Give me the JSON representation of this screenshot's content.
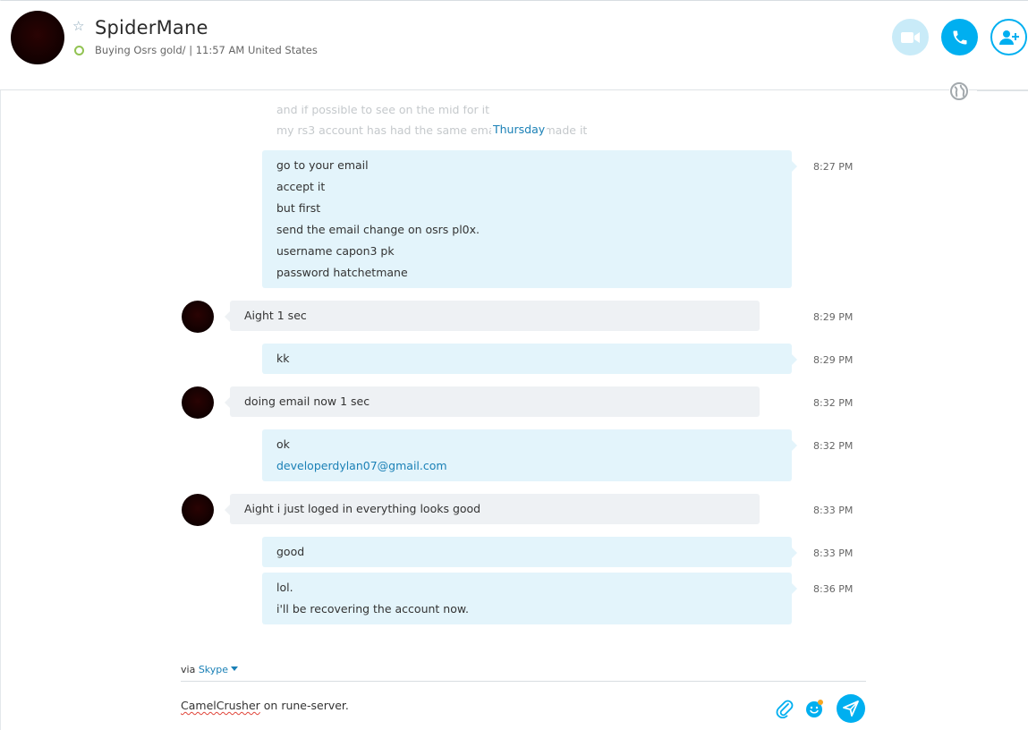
{
  "header": {
    "contact_name": "SpiderMane",
    "mood": "Buying Osrs gold/  |  11:57 AM United States",
    "colors": {
      "accent": "#00aff0",
      "presence": "#92c353"
    },
    "icons": [
      "star-icon",
      "video-call-icon",
      "phone-call-icon",
      "add-contact-icon",
      "globe-icon"
    ]
  },
  "conversation": {
    "faded_lines": [
      "and if possible to see on the mid for it",
      "my rs3 account has had the same email since I made it"
    ],
    "day_divider": "Thursday",
    "messages": [
      {
        "direction": "out",
        "time": "8:27 PM",
        "lines": [
          "go to your email",
          "accept it",
          "but first",
          "send the email change on osrs pl0x.",
          "username capon3 pk",
          "password hatchetmane"
        ]
      },
      {
        "direction": "in",
        "time": "8:29 PM",
        "lines": [
          "Aight 1 sec"
        ]
      },
      {
        "direction": "out",
        "time": "8:29 PM",
        "lines": [
          "kk"
        ]
      },
      {
        "direction": "in",
        "time": "8:32 PM",
        "lines": [
          "doing email now 1 sec"
        ]
      },
      {
        "direction": "out",
        "time": "8:32 PM",
        "lines": [
          "ok",
          "developerdylan07@gmail.com"
        ]
      },
      {
        "direction": "in",
        "time": "8:33 PM",
        "lines": [
          "Aight i just loged in everything looks good"
        ]
      },
      {
        "direction": "out",
        "time": "8:33 PM",
        "lines": [
          "good"
        ]
      },
      {
        "direction": "out",
        "time": "8:36 PM",
        "lines": [
          "lol.",
          "i'll be recovering the account now."
        ]
      }
    ]
  },
  "composer": {
    "via_label": "via",
    "via_service": "Skype",
    "text_misspelled": "CamelCrusher",
    "text_rest": " on rune-server.",
    "icons": [
      "attach-icon",
      "emoji-icon",
      "send-icon"
    ]
  }
}
